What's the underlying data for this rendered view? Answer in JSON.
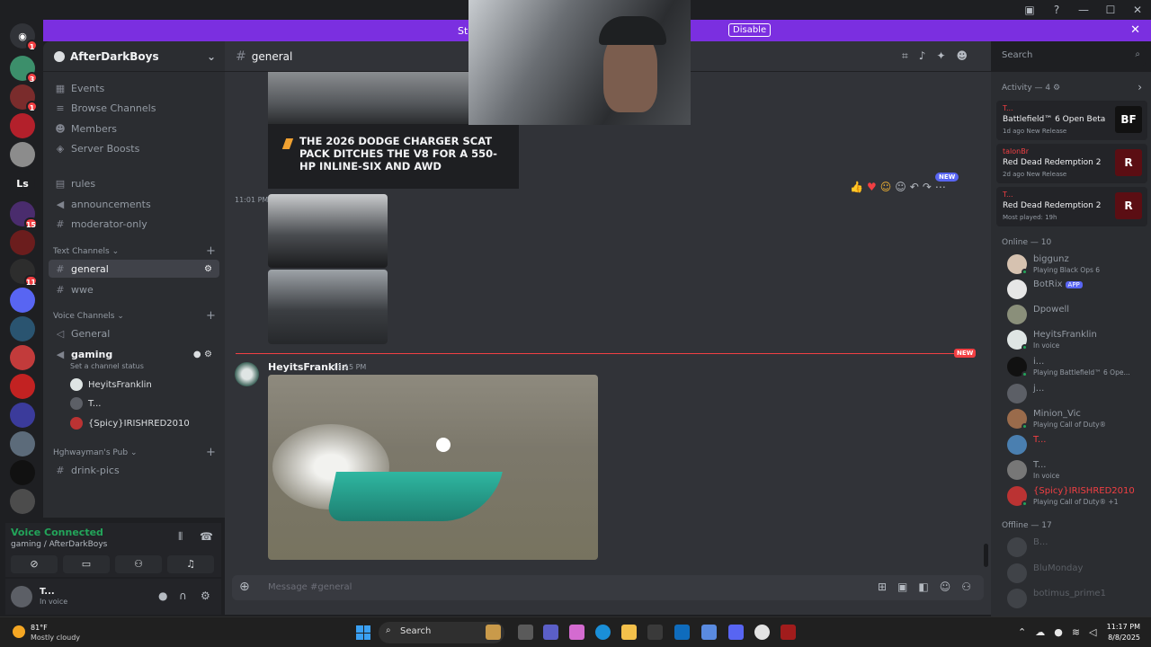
{
  "banner": {
    "text": "Str",
    "disable_label": "Disable"
  },
  "guild": {
    "name": "AfterDarkBoys"
  },
  "sidebar": {
    "top": [
      "Events",
      "Browse Channels",
      "Members",
      "Server Boosts"
    ],
    "pinned": [
      "rules",
      "announcements",
      "moderator-only"
    ],
    "text_category": "Text Channels",
    "text_channels": [
      "general",
      "wwe"
    ],
    "voice_category": "Voice Channels",
    "voice_channels": [
      "General",
      "gaming"
    ],
    "gaming_status": "Set a channel status",
    "voice_users": [
      "HeyitsFranklin",
      "T...",
      "{Spicy}IRISHRED2010"
    ],
    "pub_category": "Hghwayman's Pub",
    "pub_channels": [
      "drink-pics"
    ]
  },
  "voice_panel": {
    "status": "Voice Connected",
    "location": "gaming / AfterDarkBoys"
  },
  "user": {
    "name": "T...",
    "status": "In voice"
  },
  "chat": {
    "channel": "general",
    "search_placeholder": "Search",
    "article_title": "THE 2026 DODGE CHARGER SCAT PACK DITCHES THE V8 FOR A 550-HP INLINE-SIX AND AWD",
    "time1": "11:01 PM",
    "new_pill": "NEW",
    "new_tag": "NEW",
    "author": "HeyitsFranklin",
    "author_time": "11:15 PM",
    "composer_placeholder": "Message #general"
  },
  "activity": {
    "header": "Activity — 4",
    "items": [
      {
        "who": "T...",
        "game": "Battlefield™ 6 Open Beta",
        "meta": "1d ago  New Release",
        "art": "BF"
      },
      {
        "who": "talonBr",
        "game": "Red Dead Redemption 2",
        "meta": "2d ago  New Release",
        "art": "R"
      },
      {
        "who": "T...",
        "game": "Red Dead Redemption 2",
        "meta": "Most played: 19h",
        "art": "R"
      }
    ]
  },
  "members": {
    "online_header": "Online — 10",
    "online": [
      {
        "name": "biggunz",
        "status": "Playing Black Ops 6"
      },
      {
        "name": "BotRix",
        "status": "",
        "tag": "APP"
      },
      {
        "name": "Dpowell",
        "status": ""
      },
      {
        "name": "HeyitsFranklin",
        "status": "In voice"
      },
      {
        "name": "i...",
        "status": "Playing Battlefield™ 6 Ope..."
      },
      {
        "name": "j...",
        "status": ""
      },
      {
        "name": "Minion_Vic",
        "status": "Playing Call of Duty®"
      },
      {
        "name": "T...",
        "status": ""
      },
      {
        "name": "T...",
        "status": "In voice"
      },
      {
        "name": "{Spicy}IRISHRED2010",
        "status": "Playing Call of Duty® +1"
      }
    ],
    "offline_header": "Offline — 17",
    "offline": [
      "B...",
      "BluMonday",
      "botimus_prime1"
    ]
  },
  "taskbar": {
    "temp": "81°F",
    "weather": "Mostly cloudy",
    "search": "Search",
    "time": "11:17 PM",
    "date": "8/8/2025"
  },
  "server_badges": [
    "1",
    "3",
    "1",
    "15",
    "11"
  ],
  "server_label": "Ls"
}
